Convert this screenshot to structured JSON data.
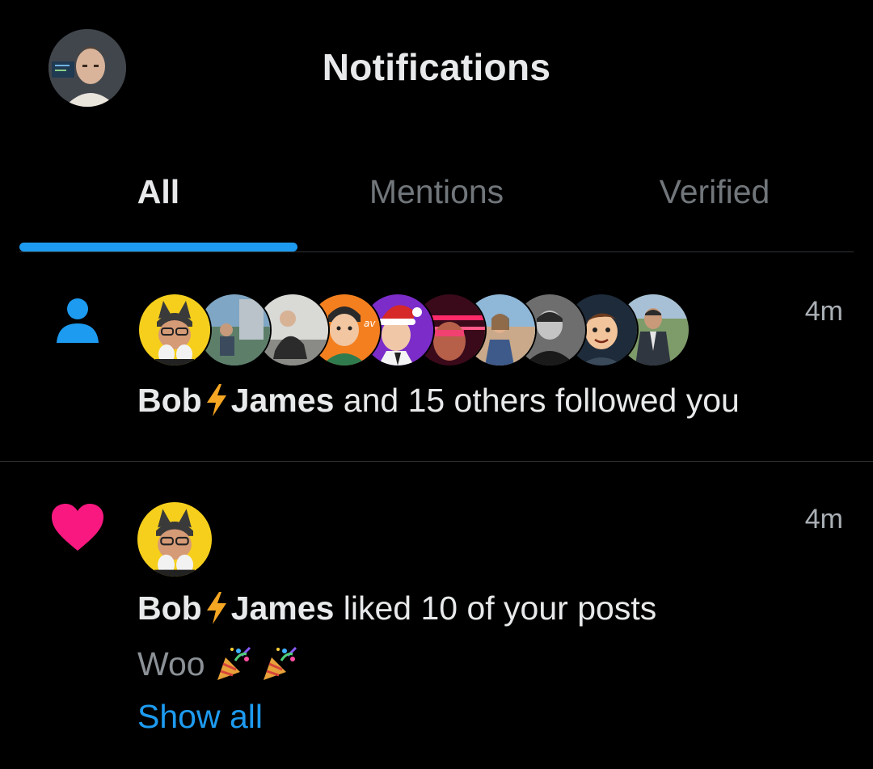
{
  "header": {
    "title": "Notifications",
    "avatar_icon": "user-avatar"
  },
  "tabs": [
    {
      "label": "All",
      "active": true
    },
    {
      "label": "Mentions",
      "active": false
    },
    {
      "label": "Verified",
      "active": false
    }
  ],
  "colors": {
    "accent": "#1d9bf0",
    "like": "#f91880",
    "background": "#000000",
    "muted": "#71767b"
  },
  "notifications": [
    {
      "type": "follow",
      "type_icon": "person-icon",
      "timestamp": "4m",
      "avatars": [
        "avatar-1",
        "avatar-2",
        "avatar-3",
        "avatar-4",
        "avatar-5",
        "avatar-6",
        "avatar-7",
        "avatar-8",
        "avatar-9",
        "avatar-10"
      ],
      "user_first": "Bob",
      "user_last": "James",
      "user_separator_icon": "lightning-bolt-icon",
      "action_text": " and 15 others followed you"
    },
    {
      "type": "like",
      "type_icon": "heart-icon",
      "timestamp": "4m",
      "avatars": [
        "avatar-1"
      ],
      "user_first": "Bob",
      "user_last": "James",
      "user_separator_icon": "lightning-bolt-icon",
      "action_text": " liked 10 of your posts",
      "post_preview": "Woo",
      "post_preview_emoji": "party-popper-icon",
      "show_all_label": "Show all"
    }
  ]
}
